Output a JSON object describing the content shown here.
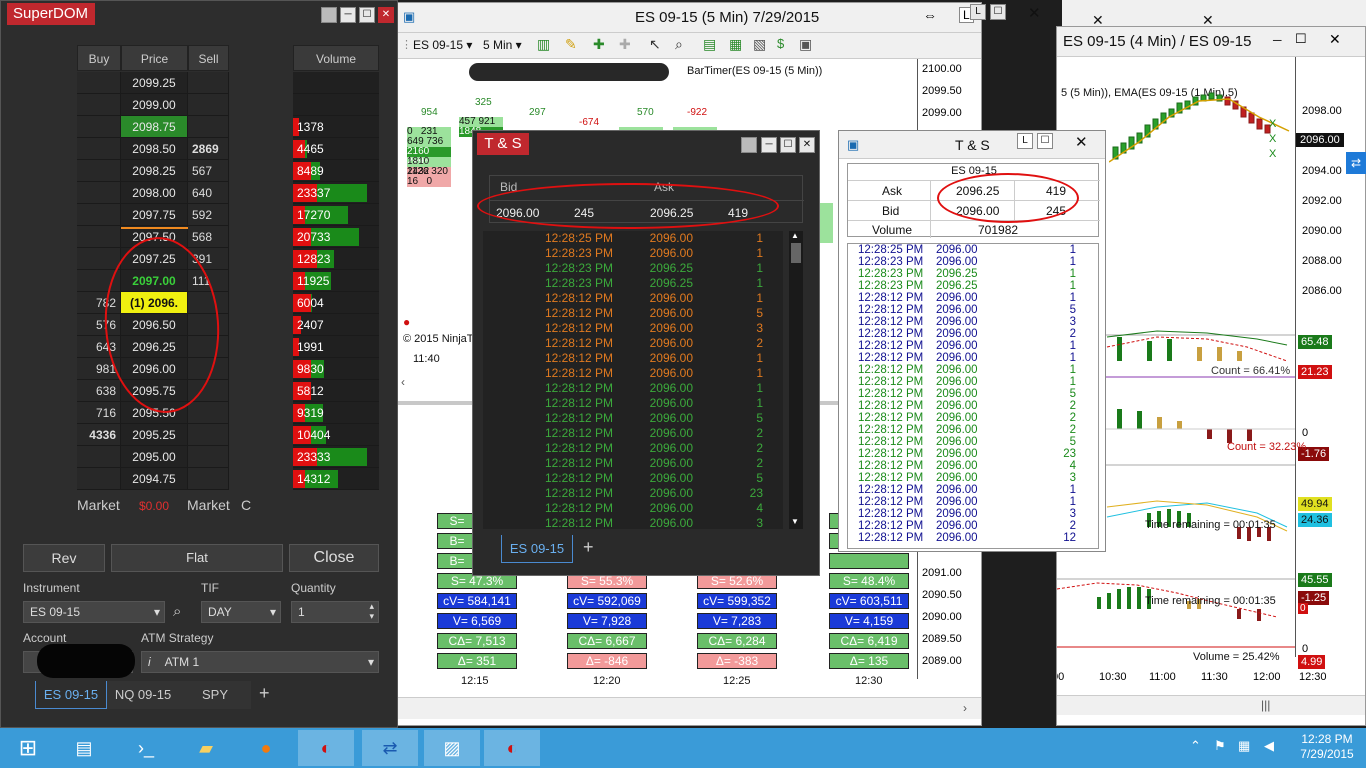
{
  "superdom": {
    "title": "SuperDOM",
    "headers": {
      "buy": "Buy",
      "price": "Price",
      "sell": "Sell",
      "volume": "Volume"
    },
    "rows": [
      {
        "buy": "",
        "price": "2099.25",
        "sell": "",
        "volume": ""
      },
      {
        "buy": "",
        "price": "2099.00",
        "sell": "",
        "volume": ""
      },
      {
        "buy": "",
        "price": "2098.75",
        "sell": "",
        "volume": "1378"
      },
      {
        "buy": "",
        "price": "2098.50",
        "sell": "2869",
        "volume": "4465"
      },
      {
        "buy": "",
        "price": "2098.25",
        "sell": "567",
        "volume": "8489"
      },
      {
        "buy": "",
        "price": "2098.00",
        "sell": "640",
        "volume": "23337"
      },
      {
        "buy": "",
        "price": "2097.75",
        "sell": "592",
        "volume": "17270"
      },
      {
        "buy": "",
        "price": "2097.50",
        "sell": "568",
        "volume": "20733"
      },
      {
        "buy": "",
        "price": "2097.25",
        "sell": "391",
        "volume": "12823"
      },
      {
        "buy": "",
        "price": "2097.00",
        "sell": "111",
        "volume": "11925"
      },
      {
        "buy": "782",
        "price": "(1) 2096.",
        "sell": "",
        "volume": "6004"
      },
      {
        "buy": "576",
        "price": "2096.50",
        "sell": "",
        "volume": "2407"
      },
      {
        "buy": "643",
        "price": "2096.25",
        "sell": "",
        "volume": "1991"
      },
      {
        "buy": "981",
        "price": "2096.00",
        "sell": "",
        "volume": "9830"
      },
      {
        "buy": "638",
        "price": "2095.75",
        "sell": "",
        "volume": "5812"
      },
      {
        "buy": "716",
        "price": "2095.50",
        "sell": "",
        "volume": "9319"
      },
      {
        "buy": "4336",
        "price": "2095.25",
        "sell": "",
        "volume": "10404"
      },
      {
        "buy": "",
        "price": "2095.00",
        "sell": "",
        "volume": "23333"
      },
      {
        "buy": "",
        "price": "2094.75",
        "sell": "",
        "volume": "14312"
      }
    ],
    "market_left": "Market",
    "pnl": "$0.00",
    "market_right": "Market",
    "c_label": "C",
    "buttons": {
      "rev": "Rev",
      "flat": "Flat",
      "close": "Close"
    },
    "instrument_label": "Instrument",
    "instrument_value": "ES 09-15",
    "tif_label": "TIF",
    "tif_value": "DAY",
    "quantity_label": "Quantity",
    "quantity_value": "1",
    "account_label": "Account",
    "atm_label": "ATM Strategy",
    "atm_value": "ATM 1",
    "tabs": [
      "ES 09-15",
      "NQ 09-15",
      "SPY"
    ],
    "add_tab": "+"
  },
  "chart5": {
    "title": "ES 09-15 (5 Min)  7/29/2015",
    "toolbar_instrument": "ES 09-15",
    "toolbar_interval": "5 Min",
    "indicator_text": "BarTimer(ES 09-15 (5 Min))",
    "price_labels": [
      "2100.00",
      "2099.50",
      "2099.00",
      "2091.00",
      "2090.50",
      "2090.00",
      "2089.50",
      "2089.00"
    ],
    "top_numbers": [
      "954",
      "325",
      "297",
      "570",
      "-674",
      "-922"
    ],
    "copyright": "© 2015 NinjaT",
    "time_left": "11:40",
    "time_axis": [
      "12:15",
      "12:20",
      "12:25",
      "12:30"
    ],
    "stats": [
      {
        "s": "S= 47.3%",
        "cv": "cV= 584,141",
        "v": "V= 6,569",
        "cd": "CΔ= 7,513",
        "d": "Δ= 351"
      },
      {
        "s": "S= 55.3%",
        "cv": "cV= 592,069",
        "v": "V= 7,928",
        "cd": "CΔ= 6,667",
        "d": "Δ= -846"
      },
      {
        "s": "S= 52.6%",
        "cv": "cV= 599,352",
        "v": "V= 7,283",
        "cd": "CΔ= 6,284",
        "d": "Δ= -383"
      },
      {
        "s": "S= 48.4%",
        "cv": "cV= 603,511",
        "v": "V= 4,159",
        "cd": "CΔ= 6,419",
        "d": "Δ= 135"
      }
    ],
    "partial_labels": [
      "S=",
      "B=",
      "B="
    ]
  },
  "chart4": {
    "title": "ES 09-15 (4 Min) / ES 09-15",
    "indicator_text": "5 (5 Min)), EMA(ES 09-15 (1 Min),5)",
    "price_labels": [
      "2098.00",
      "2096.00",
      "2094.00",
      "2092.00",
      "2090.00",
      "2088.00",
      "2086.00"
    ],
    "current_price": "2096.00",
    "panel_values": [
      "65.48",
      "21.23",
      "0",
      "-1.76",
      "49.94",
      "24.36",
      "45.55",
      "-1.25",
      "0",
      "0",
      "4.99"
    ],
    "count1": "Count = 66.41%",
    "count2": "Count = 32.23%",
    "time_remaining1": "Time remaining = 00:01:35",
    "time_remaining2": "Time remaining = 00:01:35",
    "volume_text": "Volume = 25.42%",
    "time_axis": [
      ":00",
      "10:30",
      "11:00",
      "11:30",
      "12:00",
      "12:30"
    ]
  },
  "ts_dark": {
    "title": "T & S",
    "bid_label": "Bid",
    "ask_label": "Ask",
    "bid_price": "2096.00",
    "bid_size": "245",
    "ask_price": "2096.25",
    "ask_size": "419",
    "tab": "ES 09-15",
    "add_tab": "+",
    "rows": [
      {
        "t": "12:28:25 PM",
        "p": "2096.00",
        "s": "1",
        "c": "#e07a20"
      },
      {
        "t": "12:28:23 PM",
        "p": "2096.00",
        "s": "1",
        "c": "#e07a20"
      },
      {
        "t": "12:28:23 PM",
        "p": "2096.25",
        "s": "1",
        "c": "#3caa3c"
      },
      {
        "t": "12:28:23 PM",
        "p": "2096.25",
        "s": "1",
        "c": "#3caa3c"
      },
      {
        "t": "12:28:12 PM",
        "p": "2096.00",
        "s": "1",
        "c": "#e07a20"
      },
      {
        "t": "12:28:12 PM",
        "p": "2096.00",
        "s": "5",
        "c": "#e07a20"
      },
      {
        "t": "12:28:12 PM",
        "p": "2096.00",
        "s": "3",
        "c": "#e07a20"
      },
      {
        "t": "12:28:12 PM",
        "p": "2096.00",
        "s": "2",
        "c": "#e07a20"
      },
      {
        "t": "12:28:12 PM",
        "p": "2096.00",
        "s": "1",
        "c": "#e07a20"
      },
      {
        "t": "12:28:12 PM",
        "p": "2096.00",
        "s": "1",
        "c": "#e07a20"
      },
      {
        "t": "12:28:12 PM",
        "p": "2096.00",
        "s": "1",
        "c": "#3caa3c"
      },
      {
        "t": "12:28:12 PM",
        "p": "2096.00",
        "s": "1",
        "c": "#3caa3c"
      },
      {
        "t": "12:28:12 PM",
        "p": "2096.00",
        "s": "5",
        "c": "#3caa3c"
      },
      {
        "t": "12:28:12 PM",
        "p": "2096.00",
        "s": "2",
        "c": "#3caa3c"
      },
      {
        "t": "12:28:12 PM",
        "p": "2096.00",
        "s": "2",
        "c": "#3caa3c"
      },
      {
        "t": "12:28:12 PM",
        "p": "2096.00",
        "s": "2",
        "c": "#3caa3c"
      },
      {
        "t": "12:28:12 PM",
        "p": "2096.00",
        "s": "5",
        "c": "#3caa3c"
      },
      {
        "t": "12:28:12 PM",
        "p": "2096.00",
        "s": "23",
        "c": "#3caa3c"
      },
      {
        "t": "12:28:12 PM",
        "p": "2096.00",
        "s": "4",
        "c": "#3caa3c"
      },
      {
        "t": "12:28:12 PM",
        "p": "2096.00",
        "s": "3",
        "c": "#3caa3c"
      }
    ]
  },
  "ts_light": {
    "title": "T & S",
    "instrument": "ES 09-15",
    "ask_label": "Ask",
    "ask_price": "2096.25",
    "ask_size": "419",
    "bid_label": "Bid",
    "bid_price": "2096.00",
    "bid_size": "245",
    "volume_label": "Volume",
    "volume_value": "701982",
    "rows": [
      {
        "t": "12:28:25 PM",
        "p": "2096.00",
        "s": "1",
        "c": "#101090"
      },
      {
        "t": "12:28:23 PM",
        "p": "2096.00",
        "s": "1",
        "c": "#101090"
      },
      {
        "t": "12:28:23 PM",
        "p": "2096.25",
        "s": "1",
        "c": "#1a8a1a"
      },
      {
        "t": "12:28:23 PM",
        "p": "2096.25",
        "s": "1",
        "c": "#1a8a1a"
      },
      {
        "t": "12:28:12 PM",
        "p": "2096.00",
        "s": "1",
        "c": "#101090"
      },
      {
        "t": "12:28:12 PM",
        "p": "2096.00",
        "s": "5",
        "c": "#101090"
      },
      {
        "t": "12:28:12 PM",
        "p": "2096.00",
        "s": "3",
        "c": "#101090"
      },
      {
        "t": "12:28:12 PM",
        "p": "2096.00",
        "s": "2",
        "c": "#101090"
      },
      {
        "t": "12:28:12 PM",
        "p": "2096.00",
        "s": "1",
        "c": "#101090"
      },
      {
        "t": "12:28:12 PM",
        "p": "2096.00",
        "s": "1",
        "c": "#101090"
      },
      {
        "t": "12:28:12 PM",
        "p": "2096.00",
        "s": "1",
        "c": "#1a8a1a"
      },
      {
        "t": "12:28:12 PM",
        "p": "2096.00",
        "s": "1",
        "c": "#1a8a1a"
      },
      {
        "t": "12:28:12 PM",
        "p": "2096.00",
        "s": "5",
        "c": "#1a8a1a"
      },
      {
        "t": "12:28:12 PM",
        "p": "2096.00",
        "s": "2",
        "c": "#1a8a1a"
      },
      {
        "t": "12:28:12 PM",
        "p": "2096.00",
        "s": "2",
        "c": "#1a8a1a"
      },
      {
        "t": "12:28:12 PM",
        "p": "2096.00",
        "s": "2",
        "c": "#1a8a1a"
      },
      {
        "t": "12:28:12 PM",
        "p": "2096.00",
        "s": "5",
        "c": "#1a8a1a"
      },
      {
        "t": "12:28:12 PM",
        "p": "2096.00",
        "s": "23",
        "c": "#1a8a1a"
      },
      {
        "t": "12:28:12 PM",
        "p": "2096.00",
        "s": "4",
        "c": "#1a8a1a"
      },
      {
        "t": "12:28:12 PM",
        "p": "2096.00",
        "s": "3",
        "c": "#1a8a1a"
      },
      {
        "t": "12:28:12 PM",
        "p": "2096.00",
        "s": "1",
        "c": "#101090"
      },
      {
        "t": "12:28:12 PM",
        "p": "2096.00",
        "s": "1",
        "c": "#101090"
      },
      {
        "t": "12:28:12 PM",
        "p": "2096.00",
        "s": "3",
        "c": "#101090"
      },
      {
        "t": "12:28:12 PM",
        "p": "2096.00",
        "s": "2",
        "c": "#101090"
      },
      {
        "t": "12:28:12 PM",
        "p": "2096.00",
        "s": "12",
        "c": "#101090"
      }
    ]
  },
  "taskbar": {
    "clock_time": "12:28 PM",
    "clock_date": "7/29/2015",
    "icons": [
      "windows-start-icon",
      "server-manager-icon",
      "powershell-icon",
      "file-explorer-icon",
      "firefox-icon",
      "ninjatrader-icon",
      "teamviewer-icon",
      "performance-monitor-icon",
      "ninjatrader-icon"
    ]
  }
}
